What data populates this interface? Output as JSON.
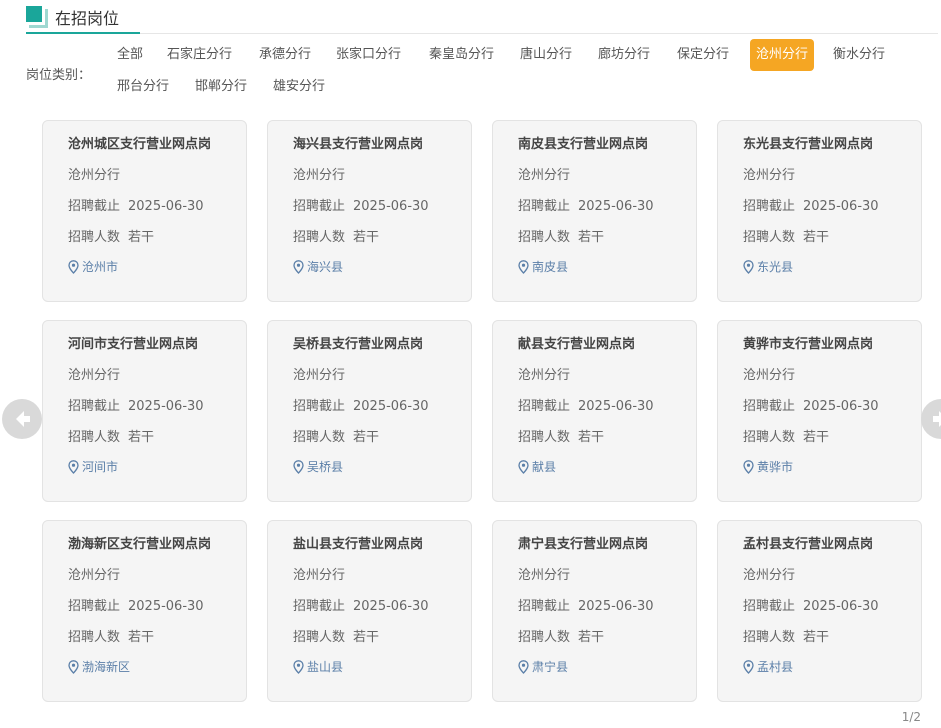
{
  "header": {
    "title": "在招岗位"
  },
  "filter": {
    "label": "岗位类别：",
    "options": [
      "全部",
      "石家庄分行",
      "承德分行",
      "张家口分行",
      "秦皇岛分行",
      "唐山分行",
      "廊坊分行",
      "保定分行",
      "沧州分行",
      "衡水分行",
      "邢台分行",
      "邯郸分行",
      "雄安分行"
    ],
    "active": "沧州分行",
    "active_color": "#f5a623"
  },
  "card_labels": {
    "deadline": "招聘截止",
    "count": "招聘人数"
  },
  "jobs": [
    {
      "title": "沧州城区支行营业网点岗",
      "branch": "沧州分行",
      "deadline": "2025-06-30",
      "count": "若干",
      "location": "沧州市"
    },
    {
      "title": "海兴县支行营业网点岗",
      "branch": "沧州分行",
      "deadline": "2025-06-30",
      "count": "若干",
      "location": "海兴县"
    },
    {
      "title": "南皮县支行营业网点岗",
      "branch": "沧州分行",
      "deadline": "2025-06-30",
      "count": "若干",
      "location": "南皮县"
    },
    {
      "title": "东光县支行营业网点岗",
      "branch": "沧州分行",
      "deadline": "2025-06-30",
      "count": "若干",
      "location": "东光县"
    },
    {
      "title": "河间市支行营业网点岗",
      "branch": "沧州分行",
      "deadline": "2025-06-30",
      "count": "若干",
      "location": "河间市"
    },
    {
      "title": "吴桥县支行营业网点岗",
      "branch": "沧州分行",
      "deadline": "2025-06-30",
      "count": "若干",
      "location": "吴桥县"
    },
    {
      "title": "献县支行营业网点岗",
      "branch": "沧州分行",
      "deadline": "2025-06-30",
      "count": "若干",
      "location": "献县"
    },
    {
      "title": "黄骅市支行营业网点岗",
      "branch": "沧州分行",
      "deadline": "2025-06-30",
      "count": "若干",
      "location": "黄骅市"
    },
    {
      "title": "渤海新区支行营业网点岗",
      "branch": "沧州分行",
      "deadline": "2025-06-30",
      "count": "若干",
      "location": "渤海新区"
    },
    {
      "title": "盐山县支行营业网点岗",
      "branch": "沧州分行",
      "deadline": "2025-06-30",
      "count": "若干",
      "location": "盐山县"
    },
    {
      "title": "肃宁县支行营业网点岗",
      "branch": "沧州分行",
      "deadline": "2025-06-30",
      "count": "若干",
      "location": "肃宁县"
    },
    {
      "title": "孟村县支行营业网点岗",
      "branch": "沧州分行",
      "deadline": "2025-06-30",
      "count": "若干",
      "location": "孟村县"
    }
  ],
  "icons": {
    "location": "location-pin-icon",
    "prev": "arrow-left-icon",
    "next": "arrow-right-icon"
  },
  "pager": {
    "text": "1/2"
  }
}
